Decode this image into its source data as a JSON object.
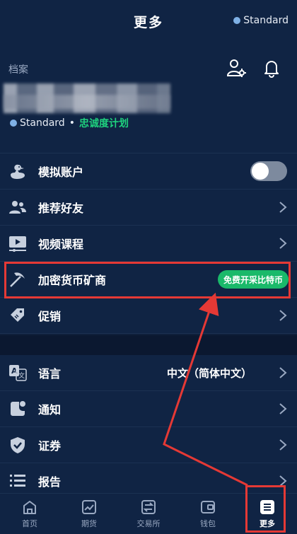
{
  "header": {
    "title": "更多",
    "account_badge": "Standard"
  },
  "profile": {
    "section_label": "档案",
    "plan": "Standard",
    "separator": "•",
    "loyalty_link": "忠诚度计划"
  },
  "menu_group_1": [
    {
      "label": "模拟账户",
      "icon": "duck-icon",
      "control": "toggle",
      "toggle_on": false
    },
    {
      "label": "推荐好友",
      "icon": "users-icon",
      "control": "chevron"
    },
    {
      "label": "视频课程",
      "icon": "video-icon",
      "control": "chevron"
    },
    {
      "label": "加密货币矿商",
      "icon": "pickaxe-icon",
      "control": "pill",
      "pill_label": "免费开采比特币"
    },
    {
      "label": "促销",
      "icon": "tag-icon",
      "control": "chevron"
    }
  ],
  "menu_group_2": [
    {
      "label": "语言",
      "icon": "translate-icon",
      "control": "chevron",
      "value": "中文（简体中文）"
    },
    {
      "label": "通知",
      "icon": "notification-icon",
      "control": "chevron"
    },
    {
      "label": "证券",
      "icon": "shield-icon",
      "control": "chevron"
    },
    {
      "label": "报告",
      "icon": "list-icon",
      "control": "chevron"
    }
  ],
  "bottom_nav": [
    {
      "label": "首页",
      "icon": "home-icon",
      "active": false
    },
    {
      "label": "期货",
      "icon": "chart-icon",
      "active": false
    },
    {
      "label": "交易所",
      "icon": "exchange-icon",
      "active": false
    },
    {
      "label": "钱包",
      "icon": "wallet-icon",
      "active": false
    },
    {
      "label": "更多",
      "icon": "menu-icon",
      "active": true
    }
  ],
  "colors": {
    "accent_green": "#1fd27e",
    "annotation_red": "#e53935",
    "background": "#102444"
  }
}
